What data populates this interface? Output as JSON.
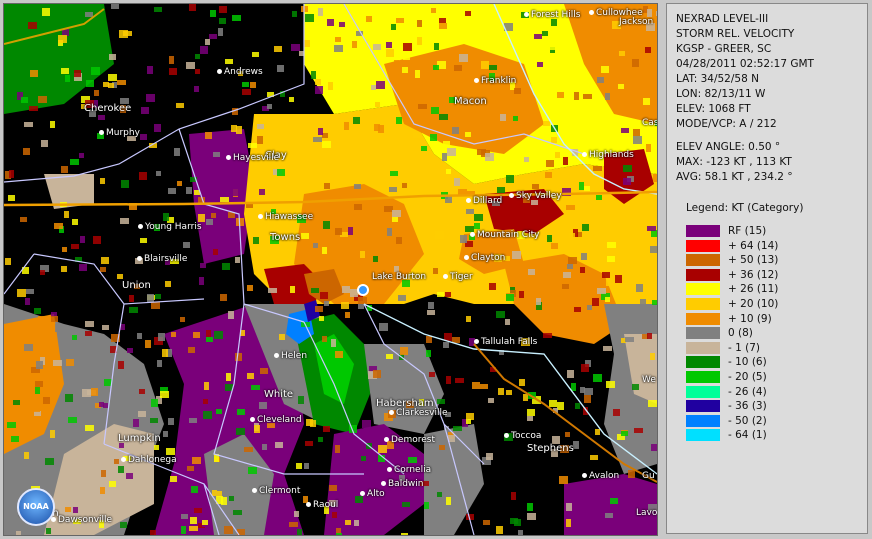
{
  "panel": {
    "product": "NEXRAD LEVEL-III",
    "type": "STORM REL. VELOCITY",
    "station": "KGSP - GREER, SC",
    "datetime": "04/28/2011 02:52:17 GMT",
    "lat": "LAT: 34/52/58 N",
    "lon": "LON: 82/13/11 W",
    "elev": "ELEV: 1068 FT",
    "mode": "MODE/VCP: A / 212",
    "elev_angle": "ELEV ANGLE: 0.50 °",
    "max": "MAX: -123 KT , 113 KT",
    "avg": "AVG: 58.1 KT , 234.2 °",
    "legend_title": "Legend: KT (Category)"
  },
  "legend": [
    {
      "label": "RF  (15)",
      "color": "#7a007a"
    },
    {
      "label": "+ 64  (14)",
      "color": "#ff0000"
    },
    {
      "label": "+ 50  (13)",
      "color": "#cc6600"
    },
    {
      "label": "+ 36  (12)",
      "color": "#a80000"
    },
    {
      "label": "+ 26  (11)",
      "color": "#ffff00"
    },
    {
      "label": "+ 20  (10)",
      "color": "#ffcc00"
    },
    {
      "label": "+ 10  (9)",
      "color": "#f08c00"
    },
    {
      "label": "0  (8)",
      "color": "#808080"
    },
    {
      "label": "- 1  (7)",
      "color": "#c8b49a"
    },
    {
      "label": "- 10  (6)",
      "color": "#008800"
    },
    {
      "label": "- 20  (5)",
      "color": "#00c800"
    },
    {
      "label": "- 26  (4)",
      "color": "#00ff99"
    },
    {
      "label": "- 36  (3)",
      "color": "#2000a0"
    },
    {
      "label": "- 50  (2)",
      "color": "#0080ff"
    },
    {
      "label": "- 64  (1)",
      "color": "#00e0ff"
    }
  ],
  "map": {
    "logo_text": "NOAA",
    "places": [
      {
        "name": "Forest Hills",
        "dot": true
      },
      {
        "name": "Cullowhee",
        "dot": true
      },
      {
        "name": "Jackson",
        "dot": false
      },
      {
        "name": "Andrews",
        "dot": true
      },
      {
        "name": "Franklin",
        "dot": true
      },
      {
        "name": "Macon",
        "dot": false
      },
      {
        "name": "Cherokee",
        "dot": false
      },
      {
        "name": "Murphy",
        "dot": true
      },
      {
        "name": "Cas",
        "dot": false
      },
      {
        "name": "Highlands",
        "dot": true
      },
      {
        "name": "Clay",
        "dot": false
      },
      {
        "name": "Hayesville",
        "dot": true
      },
      {
        "name": "Sky Valley",
        "dot": true
      },
      {
        "name": "Dillard",
        "dot": true
      },
      {
        "name": "Hiawassee",
        "dot": true
      },
      {
        "name": "Young Harris",
        "dot": true
      },
      {
        "name": "Towns",
        "dot": false
      },
      {
        "name": "Mountain City",
        "dot": true
      },
      {
        "name": "Clayton",
        "dot": true
      },
      {
        "name": "Blairsville",
        "dot": true
      },
      {
        "name": "Lake Burton",
        "dot": false
      },
      {
        "name": "Tiger",
        "dot": true
      },
      {
        "name": "Union",
        "dot": false
      },
      {
        "name": "Tallulah Falls",
        "dot": true
      },
      {
        "name": "Helen",
        "dot": true
      },
      {
        "name": "We",
        "dot": false
      },
      {
        "name": "White",
        "dot": false
      },
      {
        "name": "Habersham",
        "dot": false
      },
      {
        "name": "Clarkesville",
        "dot": true
      },
      {
        "name": "Cleveland",
        "dot": true
      },
      {
        "name": "Toccoa",
        "dot": true
      },
      {
        "name": "Stephens",
        "dot": false
      },
      {
        "name": "Lumpkin",
        "dot": false
      },
      {
        "name": "Demorest",
        "dot": true
      },
      {
        "name": "Dahlonega",
        "dot": true
      },
      {
        "name": "Cornelia",
        "dot": true
      },
      {
        "name": "Avalon",
        "dot": true
      },
      {
        "name": "Gu",
        "dot": false
      },
      {
        "name": "Baldwin",
        "dot": true
      },
      {
        "name": "Clermont",
        "dot": true
      },
      {
        "name": "Raoul",
        "dot": true
      },
      {
        "name": "Alto",
        "dot": true
      },
      {
        "name": "Dawson",
        "dot": false
      },
      {
        "name": "Dawsonville",
        "dot": true
      },
      {
        "name": "Lavo",
        "dot": false
      }
    ]
  }
}
